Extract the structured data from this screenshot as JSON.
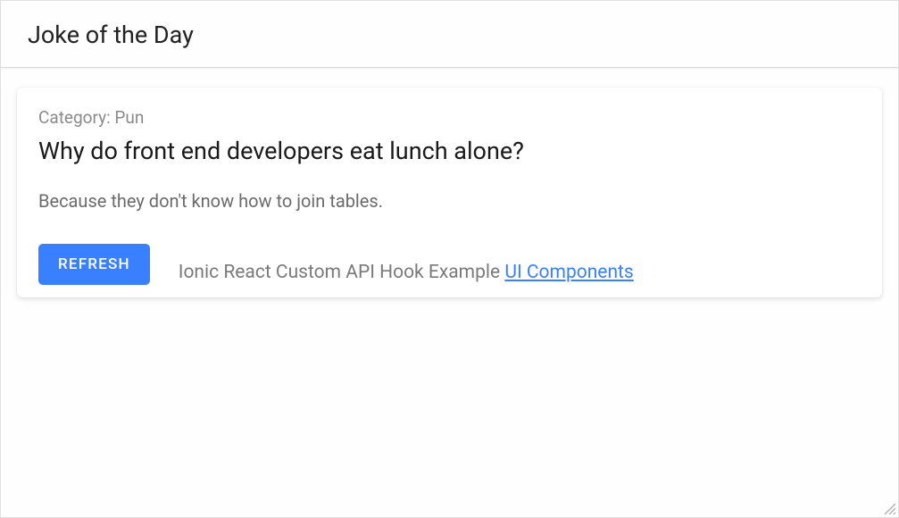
{
  "header": {
    "title": "Joke of the Day"
  },
  "card": {
    "category_prefix": "Category: ",
    "category": "Pun",
    "setup": "Why do front end developers eat lunch alone?",
    "delivery": "Because they don't know how to join tables.",
    "refresh_label": "REFRESH"
  },
  "footer": {
    "text": "Ionic React Custom API Hook Example ",
    "link_label": "UI Components"
  }
}
